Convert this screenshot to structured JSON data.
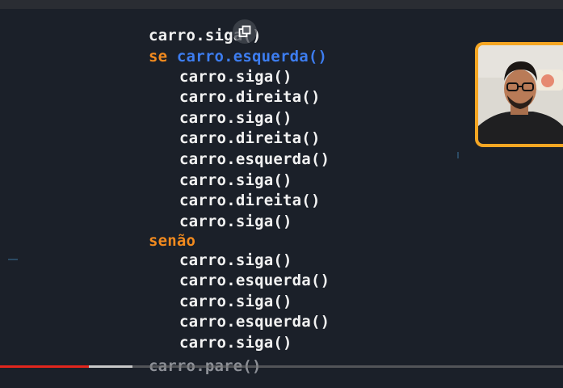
{
  "code": {
    "line1": "carro.siga()",
    "if_keyword": "se",
    "if_condition": "carro.esquerda()",
    "if_body": [
      "carro.siga()",
      "carro.direita()",
      "carro.siga()",
      "carro.direita()",
      "carro.esquerda()",
      "carro.siga()",
      "carro.direita()",
      "carro.siga()"
    ],
    "else_keyword": "senão",
    "else_body": [
      "carro.siga()",
      "carro.esquerda()",
      "carro.siga()",
      "carro.esquerda()",
      "carro.siga()"
    ],
    "last_line": "carro.pare()"
  },
  "video": {
    "played_fraction": 0.158,
    "buffered_fraction": 0.235
  },
  "colors": {
    "keyword": "#f28a1e",
    "condition": "#3d7df0",
    "text": "#f2f2f2",
    "background": "#1b2029",
    "webcam_border": "#f5a623",
    "progress": "#e2261d"
  },
  "icons": {
    "copy": "copy-icon"
  }
}
